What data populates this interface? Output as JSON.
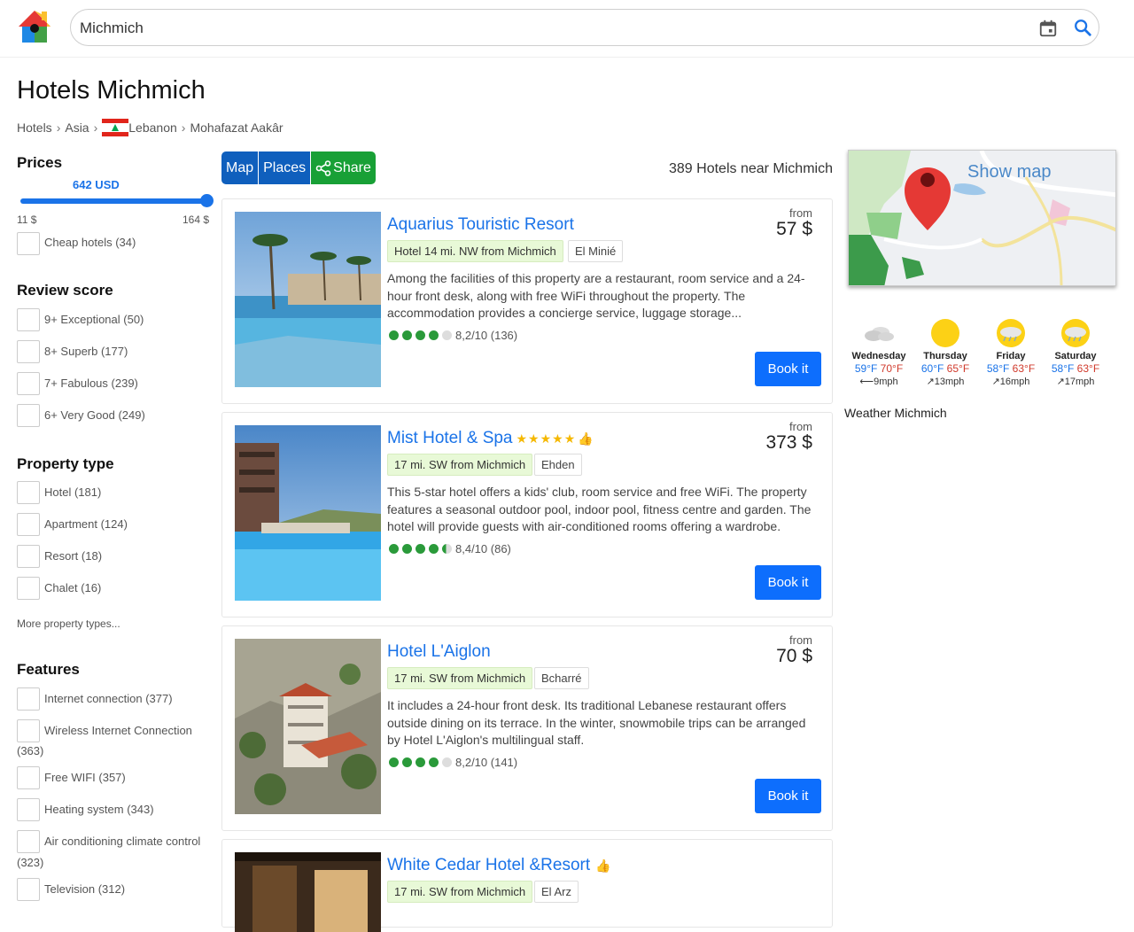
{
  "search": {
    "value": "Michmich"
  },
  "page": {
    "title": "Hotels Michmich",
    "breadcrumb": [
      "Hotels",
      "Asia",
      "Lebanon",
      "Mohafazat Aakâr"
    ]
  },
  "sidebar": {
    "prices": {
      "title": "Prices",
      "value": "642 USD",
      "min": "11 $",
      "max": "164 $",
      "cheap": "Cheap hotels (34)"
    },
    "review": {
      "title": "Review score",
      "items": [
        "9+ Exceptional (50)",
        "8+ Superb (177)",
        "7+ Fabulous (239)",
        "6+ Very Good (249)"
      ]
    },
    "property": {
      "title": "Property type",
      "items": [
        "Hotel (181)",
        "Apartment (124)",
        "Resort (18)",
        "Chalet (16)"
      ],
      "more": "More property types..."
    },
    "features": {
      "title": "Features",
      "items": [
        "Internet connection (377)",
        "Wireless Internet Connection",
        "(363)",
        "Free WIFI (357)",
        "Heating system (343)",
        "Air conditioning climate control",
        "(323)",
        "Television (312)"
      ]
    }
  },
  "toolbar": {
    "map": "Map",
    "places": "Places",
    "share": "Share",
    "count": "389 Hotels near Michmich"
  },
  "hotels": [
    {
      "name": "Aquarius Touristic Resort",
      "stars": "",
      "thumb": "",
      "distance": "Hotel 14 mi. NW from Michmich",
      "town": "El Minié",
      "desc": "Among the facilities of this property are a restaurant, room service and a 24-hour front desk, along with free WiFi throughout the property. The accommodation provides a concierge service, luggage storage...",
      "rating": "8,2/10 (136)",
      "from": "from",
      "price": "57 $",
      "book": "Book it"
    },
    {
      "name": "Mist Hotel & Spa",
      "stars": "★★★★★",
      "thumb": "👍",
      "distance": "17 mi. SW from Michmich",
      "town": "Ehden",
      "desc": "This 5-star hotel offers a kids' club, room service and free WiFi. The property features a seasonal outdoor pool, indoor pool, fitness centre and garden. The hotel will provide guests with air-conditioned rooms offering a wardrobe.",
      "rating": "8,4/10 (86)",
      "from": "from",
      "price": "373 $",
      "book": "Book it"
    },
    {
      "name": "Hotel L'Aiglon",
      "stars": "",
      "thumb": "",
      "distance": "17 mi. SW from Michmich",
      "town": "Bcharré",
      "desc": "It includes a 24-hour front desk. Its traditional Lebanese restaurant offers outside dining on its terrace. In the winter, snowmobile trips can be arranged by Hotel L'Aiglon's multilingual staff.",
      "rating": "8,2/10 (141)",
      "from": "from",
      "price": "70 $",
      "book": "Book it"
    },
    {
      "name": "White Cedar Hotel &Resort",
      "stars": "",
      "thumb": "👍",
      "distance": "17 mi. SW from Michmich",
      "town": "El Arz"
    }
  ],
  "map": {
    "label": "Show map"
  },
  "weather": {
    "title": "Weather Michmich",
    "days": [
      {
        "name": "Wednesday",
        "lo": "59°F",
        "hi": "70°F",
        "wind": "9mph",
        "icon": "cloud-icon"
      },
      {
        "name": "Thursday",
        "lo": "60°F",
        "hi": "65°F",
        "wind": "13mph",
        "icon": "sun-icon"
      },
      {
        "name": "Friday",
        "lo": "58°F",
        "hi": "63°F",
        "wind": "16mph",
        "icon": "rain-icon"
      },
      {
        "name": "Saturday",
        "lo": "58°F",
        "hi": "63°F",
        "wind": "17mph",
        "icon": "rain-icon"
      }
    ]
  },
  "colors": {
    "accent": "#1a73e8",
    "button": "#0d6efd",
    "share": "#18a036",
    "rating": "#2a9a3a"
  }
}
